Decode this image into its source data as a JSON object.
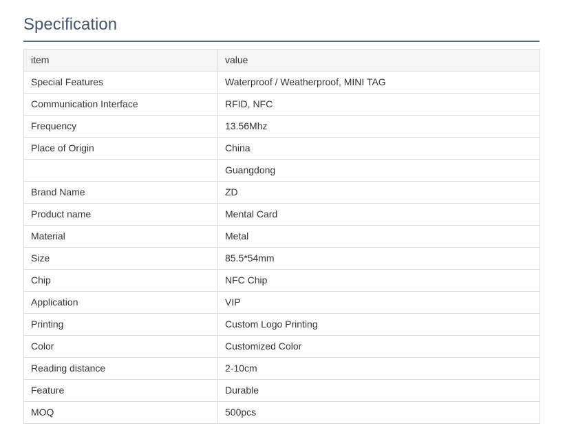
{
  "section": {
    "title": "Specification"
  },
  "table": {
    "headers": {
      "item": "item",
      "value": "value"
    },
    "rows": [
      {
        "item": "Special Features",
        "value": "Waterproof / Weatherproof, MINI TAG"
      },
      {
        "item": "Communication Interface",
        "value": "RFID, NFC"
      },
      {
        "item": "Frequency",
        "value": "13.56Mhz"
      },
      {
        "item": "Place of Origin",
        "value": "China"
      },
      {
        "item": "",
        "value": "Guangdong"
      },
      {
        "item": "Brand Name",
        "value": "ZD"
      },
      {
        "item": "Product name",
        "value": "Mental Card"
      },
      {
        "item": "Material",
        "value": "Metal"
      },
      {
        "item": "Size",
        "value": "85.5*54mm"
      },
      {
        "item": "Chip",
        "value": "NFC Chip"
      },
      {
        "item": "Application",
        "value": "VIP"
      },
      {
        "item": "Printing",
        "value": "Custom Logo Printing"
      },
      {
        "item": "Color",
        "value": "Customized Color"
      },
      {
        "item": "Reading distance",
        "value": "2-10cm"
      },
      {
        "item": "Feature",
        "value": "Durable"
      },
      {
        "item": "MOQ",
        "value": "500pcs"
      }
    ]
  }
}
